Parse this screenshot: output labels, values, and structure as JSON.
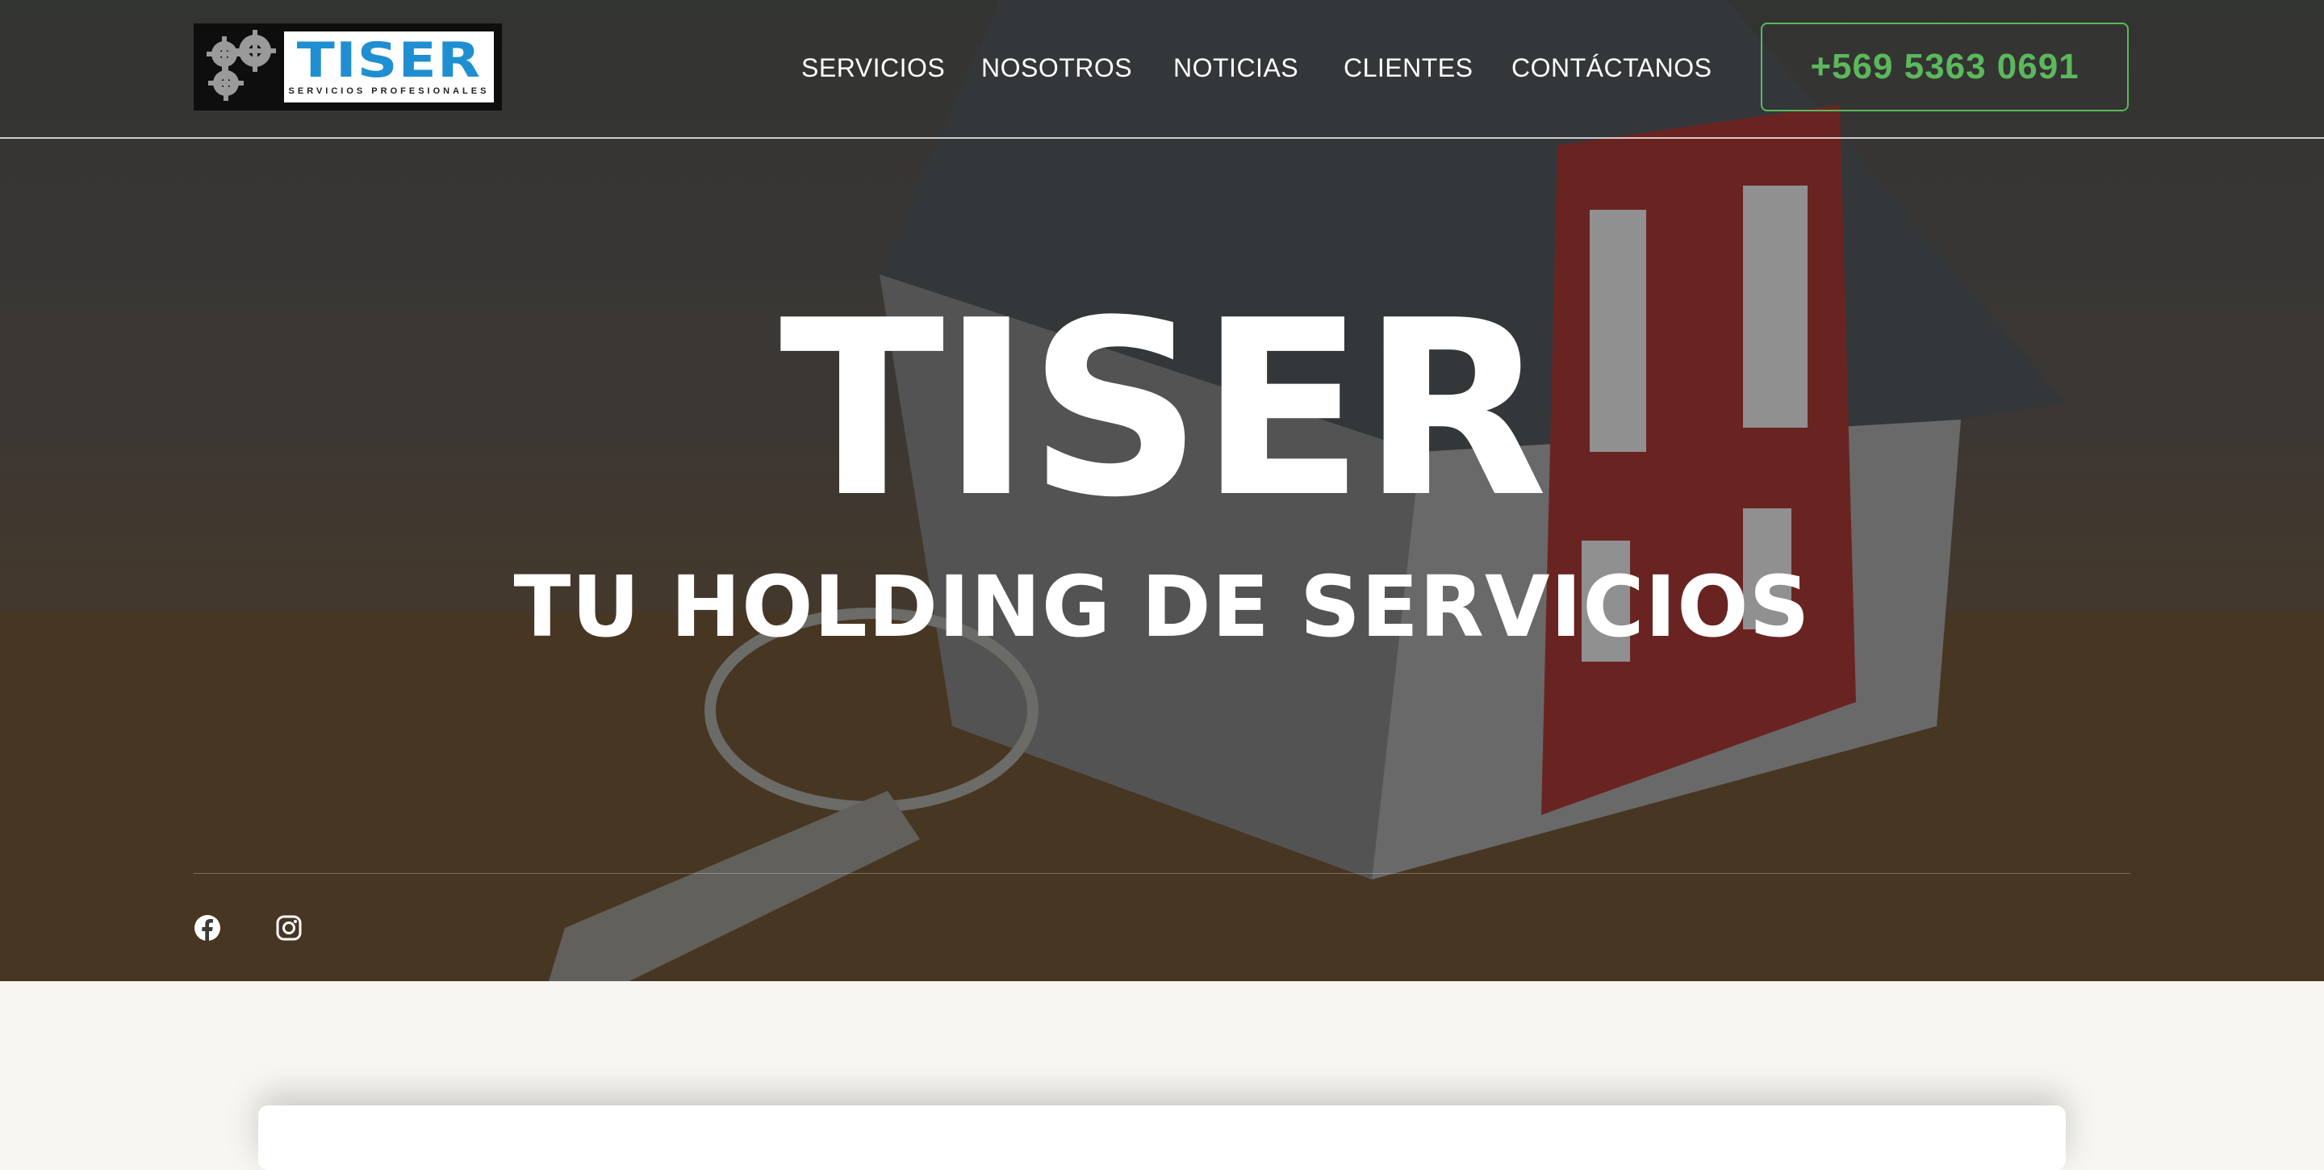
{
  "logo": {
    "word": "TISER",
    "subtitle": "SERVICIOS PROFESIONALES"
  },
  "nav": {
    "items": [
      "SERVICIOS",
      "NOSOTROS",
      "NOTICIAS",
      "CLIENTES",
      "CONTÁCTANOS"
    ]
  },
  "phone": "+569 5363 0691",
  "hero": {
    "title": "TISER",
    "subtitle": "TU HOLDING DE SERVICIOS"
  },
  "social": [
    "facebook-icon",
    "instagram-icon"
  ],
  "colors": {
    "accent": "#5cb85c",
    "logo_blue": "#1f8fd1",
    "page_bg": "#f7f6f1"
  }
}
